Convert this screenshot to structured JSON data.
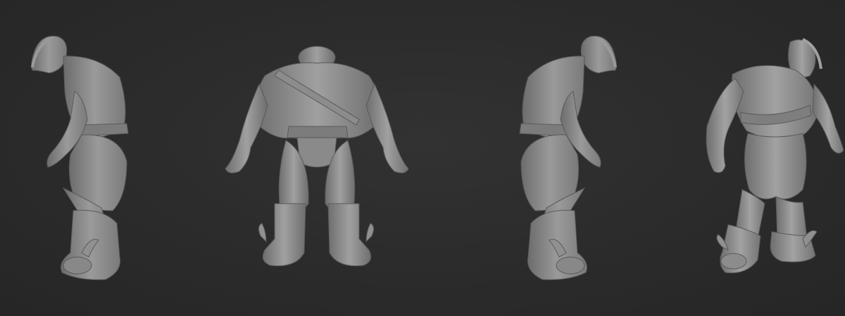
{
  "scene": {
    "background_color": "#2b2b2b",
    "material_color": "#8a8a8a",
    "views": [
      {
        "view": "left-side"
      },
      {
        "view": "back"
      },
      {
        "view": "right-side"
      },
      {
        "view": "three-quarter-front"
      }
    ]
  }
}
